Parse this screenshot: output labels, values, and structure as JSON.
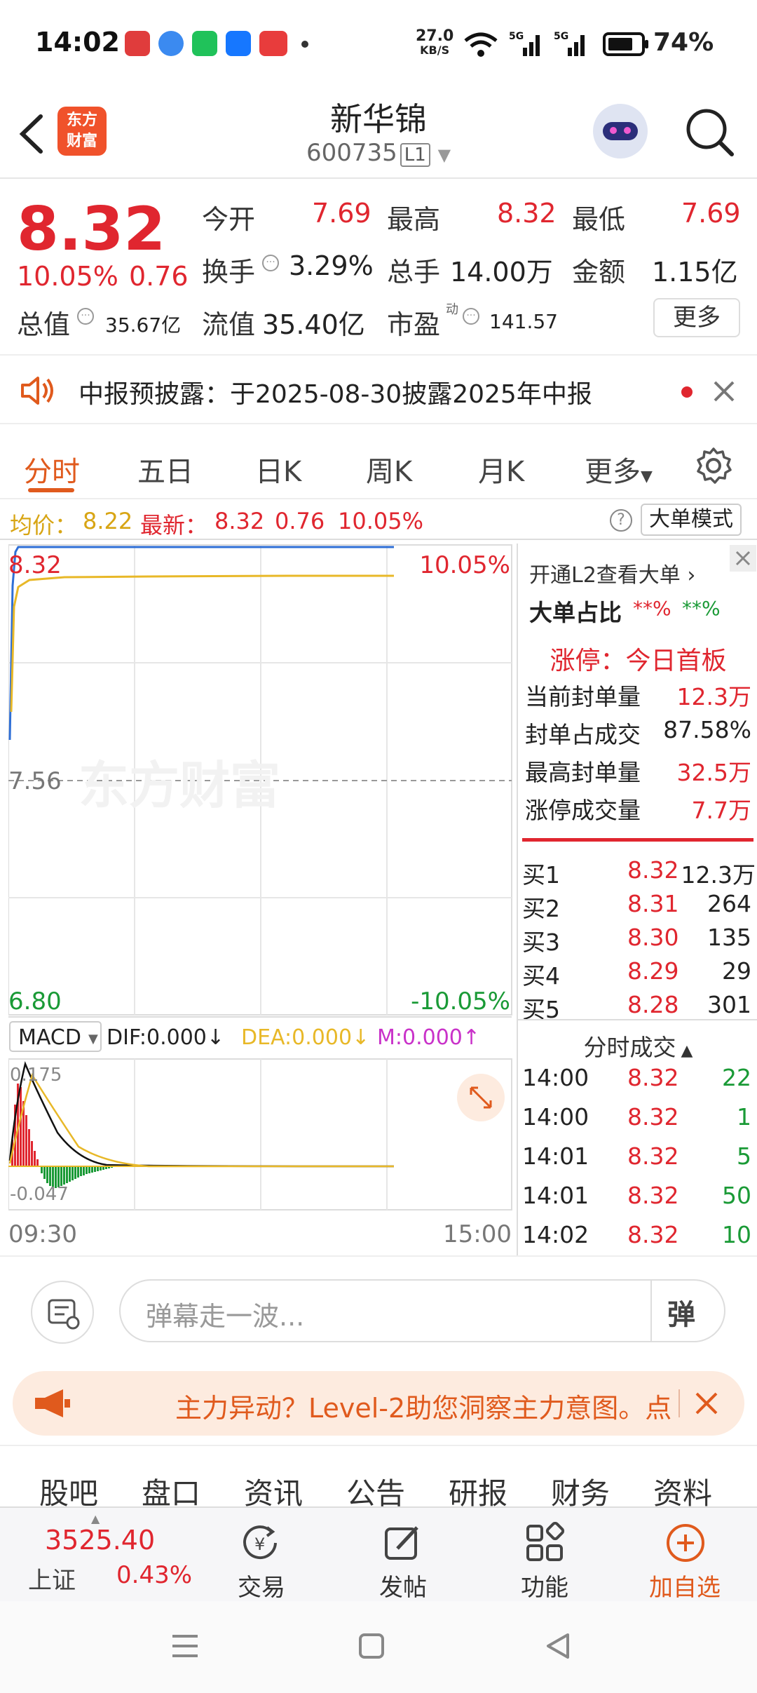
{
  "status_bar": {
    "time": "14:02",
    "speed": "27.0",
    "speed_unit": "KB/S",
    "battery": "74%"
  },
  "header": {
    "name": "新华锦",
    "code": "600735",
    "level": "L1",
    "logo_text": "东方财富"
  },
  "quote": {
    "price": "8.32",
    "change_pct": "10.05%",
    "change": "0.76",
    "open_label": "今开",
    "open": "7.69",
    "high_label": "最高",
    "high": "8.32",
    "low_label": "最低",
    "low": "7.69",
    "turnover_label": "换手",
    "turnover": "3.29%",
    "volume_label": "总手",
    "volume": "14.00万",
    "amount_label": "金额",
    "amount": "1.15亿",
    "mcap_label": "总值",
    "mcap": "35.67亿",
    "float_label": "流值",
    "float": "35.40亿",
    "pe_label": "市盈",
    "pe_sup": "动",
    "pe": "141.57",
    "more": "更多"
  },
  "notice": {
    "text": "中报预披露：于2025-08-30披露2025年中报"
  },
  "tabs": [
    "分时",
    "五日",
    "日K",
    "周K",
    "月K",
    "更多"
  ],
  "avgbar": {
    "avg_label": "均价：",
    "avg": "8.22",
    "latest_label": "最新：",
    "latest": "8.32",
    "chg": "0.76",
    "pct": "10.05%",
    "mode_btn": "大单模式"
  },
  "chart": {
    "top_price": "8.32",
    "top_pct": "10.05%",
    "mid_price": "7.56",
    "low_price": "6.80",
    "low_pct": "-10.05%",
    "watermark": "东方财富",
    "macd_label": "MACD",
    "dif": "DIF:0.000",
    "dea": "DEA:0.000",
    "m": "M:0.000",
    "macd_top": "0.175",
    "macd_bottom": "-0.047",
    "time_start": "09:30",
    "time_end": "15:00"
  },
  "right_panel": {
    "l2_link": "开通L2查看大单",
    "big_order_label": "大单占比",
    "big_buy": "**%",
    "big_sell": "**%",
    "limit_title": "涨停：今日首板",
    "limit_rows": [
      {
        "label": "当前封单量",
        "value": "12.3万"
      },
      {
        "label": "封单占成交",
        "value": "87.58%"
      },
      {
        "label": "最高封单量",
        "value": "32.5万"
      },
      {
        "label": "涨停成交量",
        "value": "7.7万"
      }
    ],
    "bids": [
      {
        "label": "买1",
        "price": "8.32",
        "vol": "12.3万"
      },
      {
        "label": "买2",
        "price": "8.31",
        "vol": "264"
      },
      {
        "label": "买3",
        "price": "8.30",
        "vol": "135"
      },
      {
        "label": "买4",
        "price": "8.29",
        "vol": "29"
      },
      {
        "label": "买5",
        "price": "8.28",
        "vol": "301"
      }
    ],
    "ticks_title": "分时成交",
    "ticks": [
      {
        "time": "14:00",
        "price": "8.32",
        "vol": "22"
      },
      {
        "time": "14:00",
        "price": "8.32",
        "vol": "1"
      },
      {
        "time": "14:01",
        "price": "8.32",
        "vol": "5"
      },
      {
        "time": "14:01",
        "price": "8.32",
        "vol": "50"
      },
      {
        "time": "14:02",
        "price": "8.32",
        "vol": "10"
      }
    ]
  },
  "danmu": {
    "placeholder": "弹幕走一波..."
  },
  "banner": {
    "text": "主力异动？Level-2助您洞察主力意图。点"
  },
  "bottom_tabs": [
    "股吧",
    "盘口",
    "资讯",
    "公告",
    "研报",
    "财务",
    "资料"
  ],
  "bottom_bar": {
    "index_value": "3525.40",
    "index_name": "上证",
    "index_pct": "0.43%",
    "trade": "交易",
    "post": "发帖",
    "func": "功能",
    "add": "加自选"
  },
  "colors": {
    "up": "#e0262f",
    "down": "#1a9a36",
    "accent": "#e05a1d",
    "price_line": "#2f6fd6",
    "avg_line": "#e8b828"
  }
}
